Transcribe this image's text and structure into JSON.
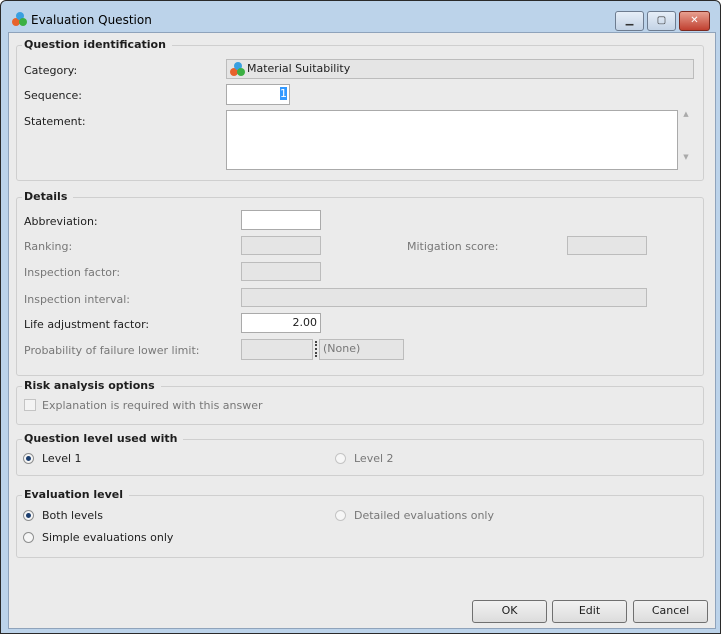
{
  "window": {
    "title": "Evaluation Question",
    "minimize": "▁",
    "maximize": "▢",
    "close": "✕"
  },
  "question_identification": {
    "title": "Question identification",
    "category_label": "Category:",
    "category_value": "Material Suitability",
    "sequence_label": "Sequence:",
    "sequence_value": "1",
    "statement_label": "Statement:",
    "statement_value": ""
  },
  "details": {
    "title": "Details",
    "abbreviation_label": "Abbreviation:",
    "abbreviation_value": "",
    "ranking_label": "Ranking:",
    "mitigation_label": "Mitigation score:",
    "inspection_factor_label": "Inspection factor:",
    "inspection_interval_label": "Inspection interval:",
    "life_adjustment_label": "Life adjustment factor:",
    "life_adjustment_value": "2.00",
    "pof_label": "Probability of failure lower limit:",
    "pof_unit": "(None)"
  },
  "risk": {
    "title": "Risk analysis options",
    "explanation_label": "Explanation is required with this answer",
    "explanation_checked": false
  },
  "level": {
    "title": "Question level used with",
    "level1": "Level 1",
    "level2": "Level 2",
    "selected": "Level 1"
  },
  "evaluation": {
    "title": "Evaluation level",
    "both": "Both levels",
    "detailed": "Detailed evaluations only",
    "simple": "Simple evaluations only",
    "selected": "Both levels"
  },
  "buttons": {
    "ok": "OK",
    "edit": "Edit",
    "cancel": "Cancel"
  },
  "colors": {
    "frame": "#bcd3ea",
    "client": "#ebebeb",
    "close": "#c75050",
    "selection": "#3399ff"
  }
}
